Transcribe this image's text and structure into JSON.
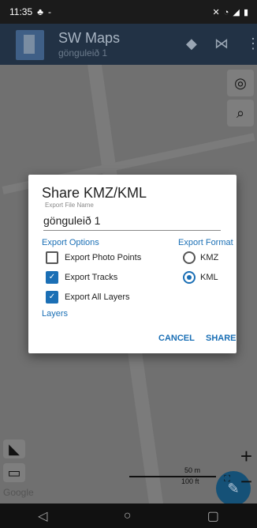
{
  "status_bar": {
    "time": "11:35",
    "extra": "-",
    "right_icons": "NFC wifi signal battery"
  },
  "app_bar": {
    "title": "SW Maps",
    "subtitle": "gönguleið 1",
    "icons": [
      "layers-icon",
      "rec-icon",
      "more-vert-icon"
    ]
  },
  "map": {
    "google_label": "Google",
    "scale_metric": "50 m",
    "scale_imperial": "100 ft"
  },
  "dialog": {
    "title": "Share KMZ/KML",
    "file_name_label": "Export File Name",
    "file_name_value": "gönguleið 1",
    "options_header": "Export Options",
    "format_header": "Export Format",
    "options": [
      {
        "label": "Export Photo Points",
        "checked": false
      },
      {
        "label": "Export Tracks",
        "checked": true
      },
      {
        "label": "Export All Layers",
        "checked": true
      }
    ],
    "formats": [
      {
        "label": "KMZ",
        "selected": false
      },
      {
        "label": "KML",
        "selected": true
      }
    ],
    "layers_link": "Layers",
    "cancel_label": "CANCEL",
    "share_label": "SHARE"
  },
  "colors": {
    "accent": "#1b6fb5",
    "app_bar": "#223245",
    "scrim": "#6e6e6e"
  }
}
